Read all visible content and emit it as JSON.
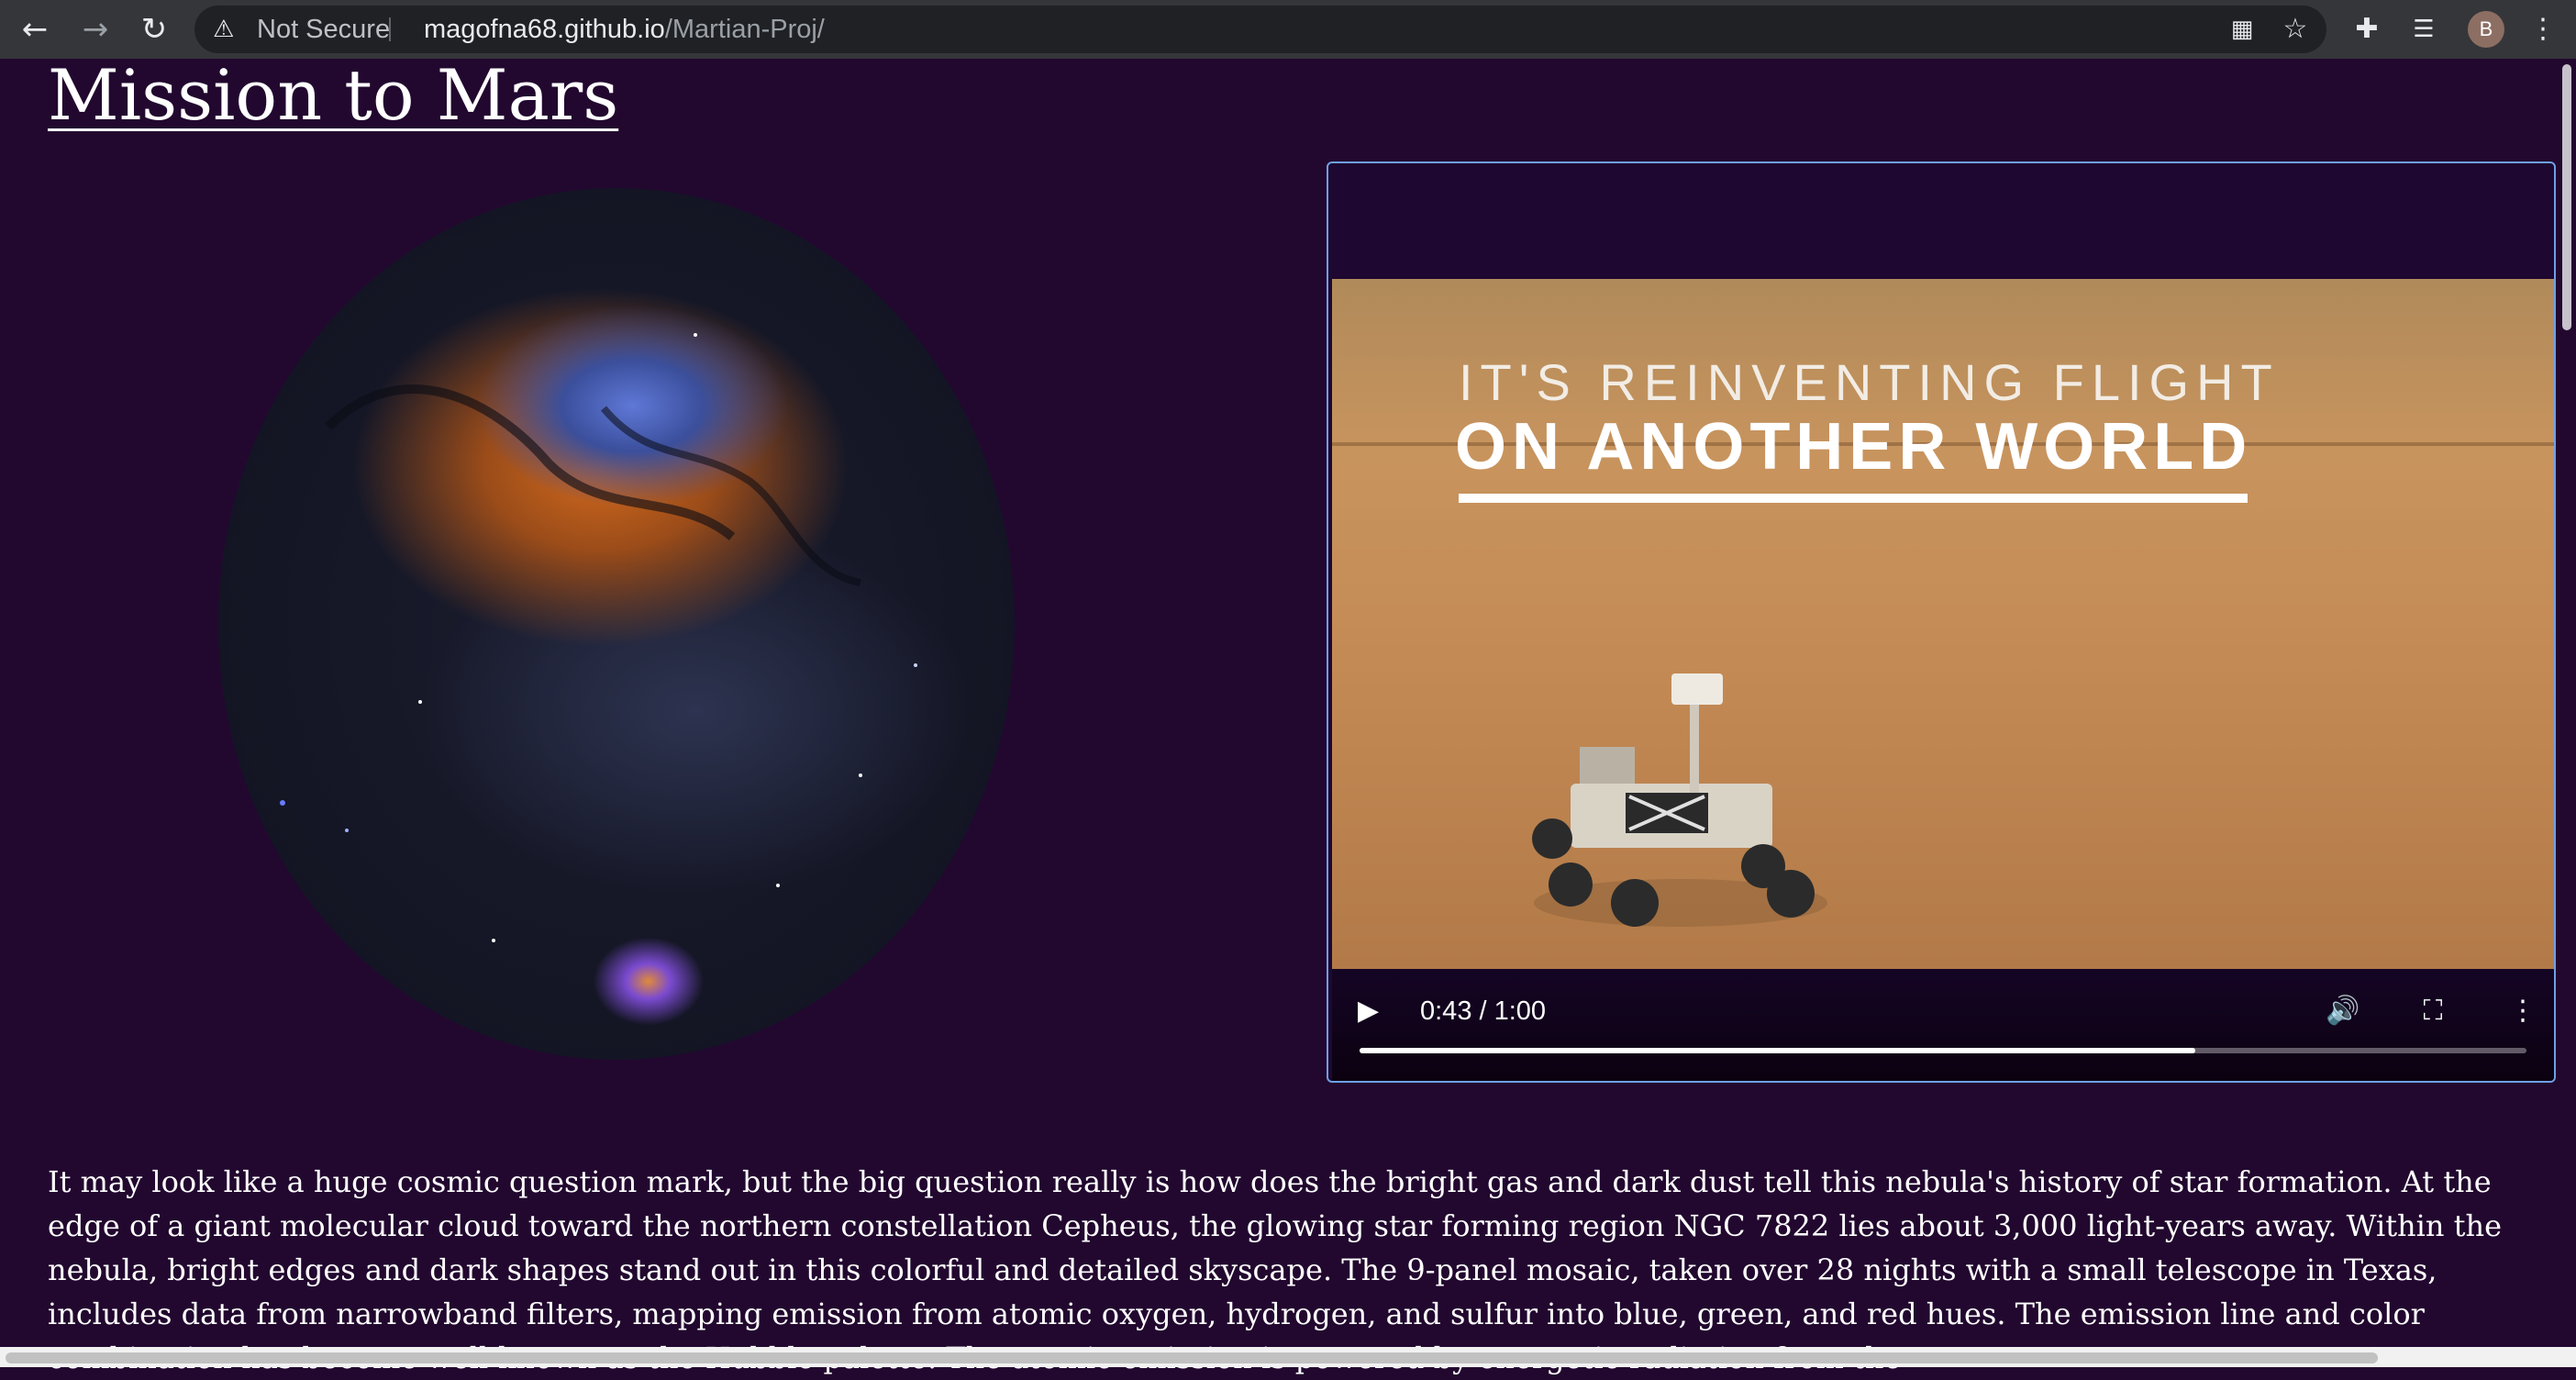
{
  "browser": {
    "not_secure_label": "Not Secure",
    "url_host": "magofna68.github.io",
    "url_path": "/Martian-Proj/",
    "avatar_letter": "B",
    "icons": [
      "back-icon",
      "forward-icon",
      "reload-icon",
      "warning-icon",
      "qr-icon",
      "star-icon",
      "extensions-icon",
      "media-icon",
      "menu-icon"
    ]
  },
  "page": {
    "title": "Mission to Mars",
    "background_color": "#22082f",
    "video": {
      "title_line1": "IT'S REINVENTING FLIGHT",
      "title_line2": "ON ANOTHER WORLD",
      "time": "0:43 / 1:00",
      "progress": 0.716
    },
    "description": "It may look like a huge cosmic question mark, but the big question really is how does the bright gas and dark dust tell this nebula's history of star formation. At the edge of a giant molecular cloud toward the northern constellation Cepheus, the glowing star forming region NGC 7822 lies about 3,000 light-years away. Within the nebula, bright edges and dark shapes stand out in this colorful and detailed skyscape. The 9-panel mosaic, taken over 28 nights with a small telescope in Texas, includes data from narrowband filters, mapping emission from atomic oxygen, hydrogen, and sulfur into blue, green, and red hues. The emission line and color combination has become well-known as the Hubble palette. The atomic emission is powered by energetic radiation from the"
  }
}
